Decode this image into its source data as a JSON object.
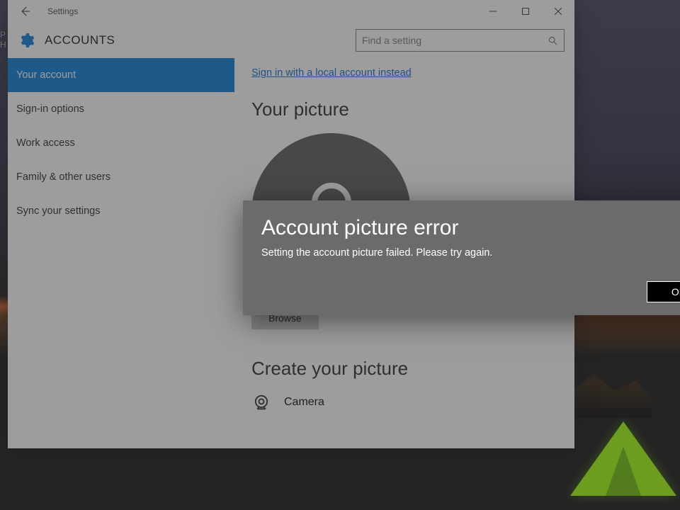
{
  "desktop": {
    "left_text_line1": "P",
    "left_text_line2": "H"
  },
  "window": {
    "title": "Settings",
    "section": "ACCOUNTS",
    "search_placeholder": "Find a setting"
  },
  "sidebar": {
    "items": [
      {
        "label": "Your account",
        "selected": true
      },
      {
        "label": "Sign-in options",
        "selected": false
      },
      {
        "label": "Work access",
        "selected": false
      },
      {
        "label": "Family & other users",
        "selected": false
      },
      {
        "label": "Sync your settings",
        "selected": false
      }
    ]
  },
  "content": {
    "signin_link": "Sign in with a local account instead",
    "picture_heading": "Your picture",
    "browse_label": "Browse",
    "create_heading": "Create your picture",
    "camera_label": "Camera"
  },
  "dialog": {
    "title": "Account picture error",
    "message": "Setting the account picture failed. Please try again.",
    "ok_label": "OK"
  }
}
